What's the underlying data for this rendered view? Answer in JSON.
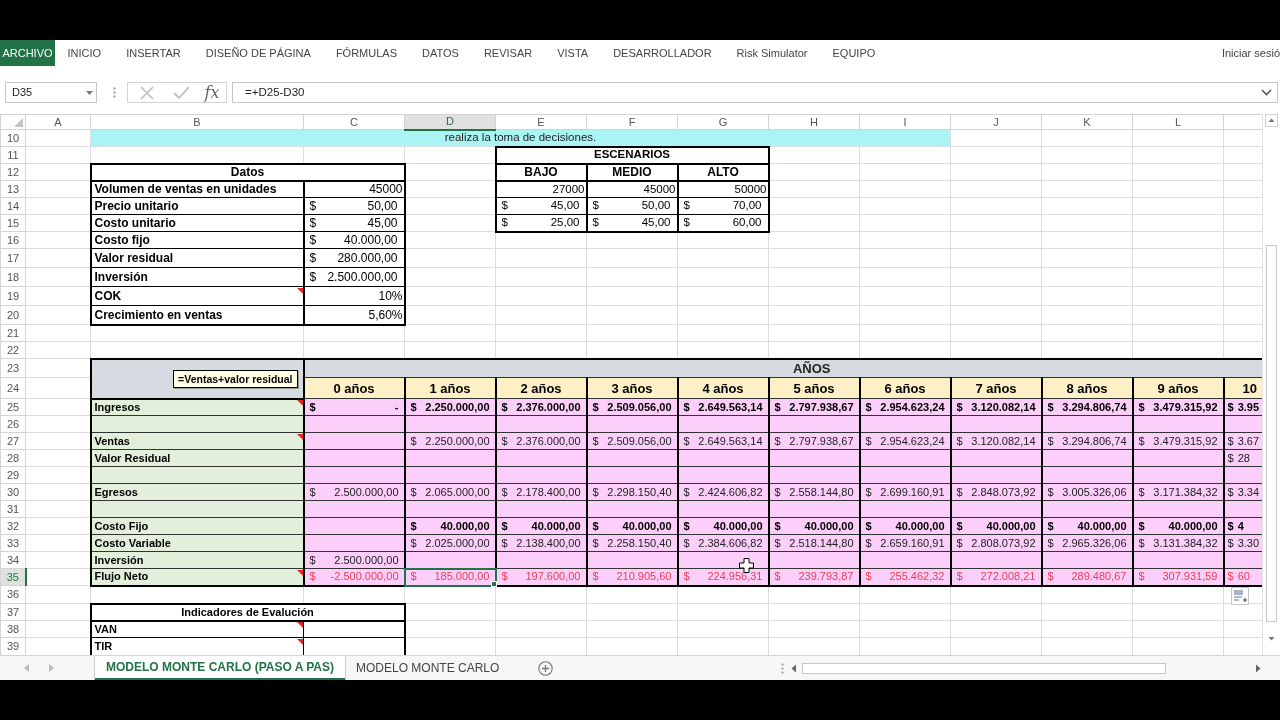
{
  "ribbon": {
    "tabs": [
      {
        "label": "ARCHIVO",
        "kind": "file"
      },
      {
        "label": "INICIO",
        "kind": "tab"
      },
      {
        "label": "INSERTAR",
        "kind": "tab"
      },
      {
        "label": "DISEÑO DE PÁGINA",
        "kind": "tab"
      },
      {
        "label": "FÓRMULAS",
        "kind": "tab"
      },
      {
        "label": "DATOS",
        "kind": "tab"
      },
      {
        "label": "REVISAR",
        "kind": "tab"
      },
      {
        "label": "VISTA",
        "kind": "tab"
      },
      {
        "label": "DESARROLLADOR",
        "kind": "tab"
      },
      {
        "label": "Risk Simulator",
        "kind": "tab"
      },
      {
        "label": "EQUIPO",
        "kind": "tab"
      }
    ],
    "account": "Iniciar sesió"
  },
  "formula_bar": {
    "name_box": "D35",
    "function_button": "fx",
    "formula": "=+D25-D30"
  },
  "columns": [
    {
      "label": "A",
      "selected": false
    },
    {
      "label": "B",
      "selected": false
    },
    {
      "label": "C",
      "selected": false
    },
    {
      "label": "D",
      "selected": true
    },
    {
      "label": "E",
      "selected": false
    },
    {
      "label": "F",
      "selected": false
    },
    {
      "label": "G",
      "selected": false
    },
    {
      "label": "H",
      "selected": false
    },
    {
      "label": "I",
      "selected": false
    },
    {
      "label": "J",
      "selected": false
    },
    {
      "label": "K",
      "selected": false
    },
    {
      "label": "L",
      "selected": false
    }
  ],
  "rows": [
    {
      "label": "10",
      "selected": false
    },
    {
      "label": "11",
      "selected": false
    },
    {
      "label": "12",
      "selected": false
    },
    {
      "label": "13",
      "selected": false
    },
    {
      "label": "14",
      "selected": false
    },
    {
      "label": "15",
      "selected": false
    },
    {
      "label": "16",
      "selected": false
    },
    {
      "label": "17",
      "selected": false
    },
    {
      "label": "18",
      "selected": false
    },
    {
      "label": "19",
      "selected": false
    },
    {
      "label": "20",
      "selected": false
    },
    {
      "label": "21",
      "selected": false
    },
    {
      "label": "22",
      "selected": false
    },
    {
      "label": "23",
      "selected": false
    },
    {
      "label": "24",
      "selected": false
    },
    {
      "label": "25",
      "selected": false
    },
    {
      "label": "26",
      "selected": false
    },
    {
      "label": "27",
      "selected": false
    },
    {
      "label": "28",
      "selected": false
    },
    {
      "label": "29",
      "selected": false
    },
    {
      "label": "30",
      "selected": false
    },
    {
      "label": "31",
      "selected": false
    },
    {
      "label": "32",
      "selected": false
    },
    {
      "label": "33",
      "selected": false
    },
    {
      "label": "34",
      "selected": false
    },
    {
      "label": "35",
      "selected": true
    },
    {
      "label": "36",
      "selected": false
    },
    {
      "label": "37",
      "selected": false
    },
    {
      "label": "38",
      "selected": false
    },
    {
      "label": "39",
      "selected": false
    }
  ],
  "banner": {
    "text": "realiza la toma de decisiones."
  },
  "datos": {
    "title": "Datos",
    "rows": [
      {
        "label": "Volumen de ventas en unidades",
        "value": "45000",
        "comment": false
      },
      {
        "label": "Precio unitario",
        "symbol": "$",
        "value": "50,00",
        "comment": false
      },
      {
        "label": "Costo unitario",
        "symbol": "$",
        "value": "45,00",
        "comment": false
      },
      {
        "label": "Costo fijo",
        "symbol": "$",
        "value": "40.000,00",
        "comment": false
      },
      {
        "label": "Valor residual",
        "symbol": "$",
        "value": "280.000,00",
        "comment": false
      },
      {
        "label": "Inversión",
        "symbol": "$",
        "value": "2.500.000,00",
        "comment": false
      },
      {
        "label": "COK",
        "value": "10%",
        "comment": true
      },
      {
        "label": "Crecimiento en ventas",
        "value": "5,60%",
        "comment": false
      }
    ]
  },
  "escenarios": {
    "title": "ESCENARIOS",
    "headers": [
      "BAJO",
      "MEDIO",
      "ALTO"
    ],
    "rows": [
      [
        {
          "value": "27000"
        },
        {
          "value": "45000"
        },
        {
          "value": "50000"
        }
      ],
      [
        {
          "symbol": "$",
          "value": "45,00"
        },
        {
          "symbol": "$",
          "value": "50,00"
        },
        {
          "symbol": "$",
          "value": "70,00"
        }
      ],
      [
        {
          "symbol": "$",
          "value": "25,00"
        },
        {
          "symbol": "$",
          "value": "45,00"
        },
        {
          "symbol": "$",
          "value": "60,00"
        }
      ]
    ]
  },
  "flujo": {
    "header": "AÑOS",
    "comment_box": "=Ventas+valor residual",
    "years": [
      "0 años",
      "1 años",
      "2 años",
      "3 años",
      "4 años",
      "5 años",
      "6 años",
      "7 años",
      "8 años",
      "9 años",
      "10"
    ],
    "rows": [
      {
        "label": "Ingresos",
        "kind": "strong",
        "comment": true,
        "cells": [
          {
            "symbol": "$",
            "value": "-"
          },
          {
            "symbol": "$",
            "value": "2.250.000,00"
          },
          {
            "symbol": "$",
            "value": "2.376.000,00"
          },
          {
            "symbol": "$",
            "value": "2.509.056,00"
          },
          {
            "symbol": "$",
            "value": "2.649.563,14"
          },
          {
            "symbol": "$",
            "value": "2.797.938,67"
          },
          {
            "symbol": "$",
            "value": "2.954.623,24"
          },
          {
            "symbol": "$",
            "value": "3.120.082,14"
          },
          {
            "symbol": "$",
            "value": "3.294.806,74"
          },
          {
            "symbol": "$",
            "value": "3.479.315,92"
          },
          {
            "symbol": "$",
            "value": "3.95"
          }
        ]
      },
      {
        "kind": "spacer",
        "comment": false
      },
      {
        "label": "Ventas",
        "kind": "normal",
        "comment": true,
        "cells": [
          null,
          {
            "symbol": "$",
            "value": "2.250.000,00"
          },
          {
            "symbol": "$",
            "value": "2.376.000,00"
          },
          {
            "symbol": "$",
            "value": "2.509.056,00"
          },
          {
            "symbol": "$",
            "value": "2.649.563,14"
          },
          {
            "symbol": "$",
            "value": "2.797.938,67"
          },
          {
            "symbol": "$",
            "value": "2.954.623,24"
          },
          {
            "symbol": "$",
            "value": "3.120.082,14"
          },
          {
            "symbol": "$",
            "value": "3.294.806,74"
          },
          {
            "symbol": "$",
            "value": "3.479.315,92"
          },
          {
            "symbol": "$",
            "value": "3.67"
          }
        ]
      },
      {
        "label": "Valor Residual",
        "kind": "normal",
        "comment": false,
        "cells": [
          null,
          null,
          null,
          null,
          null,
          null,
          null,
          null,
          null,
          null,
          {
            "symbol": "$",
            "value": "28"
          }
        ]
      },
      {
        "kind": "spacer",
        "comment": false
      },
      {
        "label": "Egresos",
        "kind": "normal",
        "comment": false,
        "cells": [
          {
            "symbol": "$",
            "value": "2.500.000,00"
          },
          {
            "symbol": "$",
            "value": "2.065.000,00"
          },
          {
            "symbol": "$",
            "value": "2.178.400,00"
          },
          {
            "symbol": "$",
            "value": "2.298.150,40"
          },
          {
            "symbol": "$",
            "value": "2.424.606,82"
          },
          {
            "symbol": "$",
            "value": "2.558.144,80"
          },
          {
            "symbol": "$",
            "value": "2.699.160,91"
          },
          {
            "symbol": "$",
            "value": "2.848.073,92"
          },
          {
            "symbol": "$",
            "value": "3.005.326,06"
          },
          {
            "symbol": "$",
            "value": "3.171.384,32"
          },
          {
            "symbol": "$",
            "value": "3.34"
          }
        ]
      },
      {
        "kind": "spacer",
        "comment": false
      },
      {
        "label": "Costo Fijo",
        "kind": "strong",
        "comment": false,
        "cells": [
          null,
          {
            "symbol": "$",
            "value": "40.000,00"
          },
          {
            "symbol": "$",
            "value": "40.000,00"
          },
          {
            "symbol": "$",
            "value": "40.000,00"
          },
          {
            "symbol": "$",
            "value": "40.000,00"
          },
          {
            "symbol": "$",
            "value": "40.000,00"
          },
          {
            "symbol": "$",
            "value": "40.000,00"
          },
          {
            "symbol": "$",
            "value": "40.000,00"
          },
          {
            "symbol": "$",
            "value": "40.000,00"
          },
          {
            "symbol": "$",
            "value": "40.000,00"
          },
          {
            "symbol": "$",
            "value": "4"
          }
        ]
      },
      {
        "label": "Costo Variable",
        "kind": "normal",
        "comment": false,
        "cells": [
          null,
          {
            "symbol": "$",
            "value": "2.025.000,00"
          },
          {
            "symbol": "$",
            "value": "2.138.400,00"
          },
          {
            "symbol": "$",
            "value": "2.258.150,40"
          },
          {
            "symbol": "$",
            "value": "2.384.606,82"
          },
          {
            "symbol": "$",
            "value": "2.518.144,80"
          },
          {
            "symbol": "$",
            "value": "2.659.160,91"
          },
          {
            "symbol": "$",
            "value": "2.808.073,92"
          },
          {
            "symbol": "$",
            "value": "2.965.326,06"
          },
          {
            "symbol": "$",
            "value": "3.131.384,32"
          },
          {
            "symbol": "$",
            "value": "3.30"
          }
        ]
      },
      {
        "label": "Inversión",
        "kind": "normal",
        "comment": false,
        "cells": [
          {
            "symbol": "$",
            "value": "2.500.000,00"
          },
          null,
          null,
          null,
          null,
          null,
          null,
          null,
          null,
          null,
          null
        ]
      },
      {
        "label": "Flujo Neto",
        "kind": "result",
        "comment": true,
        "cells": [
          {
            "symbol": "$",
            "value": "-2.500.000,00"
          },
          {
            "symbol": "$",
            "value": "185.000,00"
          },
          {
            "symbol": "$",
            "value": "197.600,00"
          },
          {
            "symbol": "$",
            "value": "210.905,60"
          },
          {
            "symbol": "$",
            "value": "224.956,31"
          },
          {
            "symbol": "$",
            "value": "239.793,87"
          },
          {
            "symbol": "$",
            "value": "255.462,32"
          },
          {
            "symbol": "$",
            "value": "272.008,21"
          },
          {
            "symbol": "$",
            "value": "289.480,67"
          },
          {
            "symbol": "$",
            "value": "307.931,59"
          },
          {
            "symbol": "$",
            "value": "60"
          }
        ]
      }
    ]
  },
  "indicadores": {
    "title": "Indicadores de Evalución",
    "rows": [
      {
        "label": "VAN",
        "comment": true
      },
      {
        "label": "TIR",
        "comment": true
      }
    ]
  },
  "sheet_tabs": [
    {
      "label": "MODELO MONTE CARLO (PASO A PAS)",
      "selected": true
    },
    {
      "label": "MODELO MONTE CARLO",
      "selected": false
    }
  ]
}
